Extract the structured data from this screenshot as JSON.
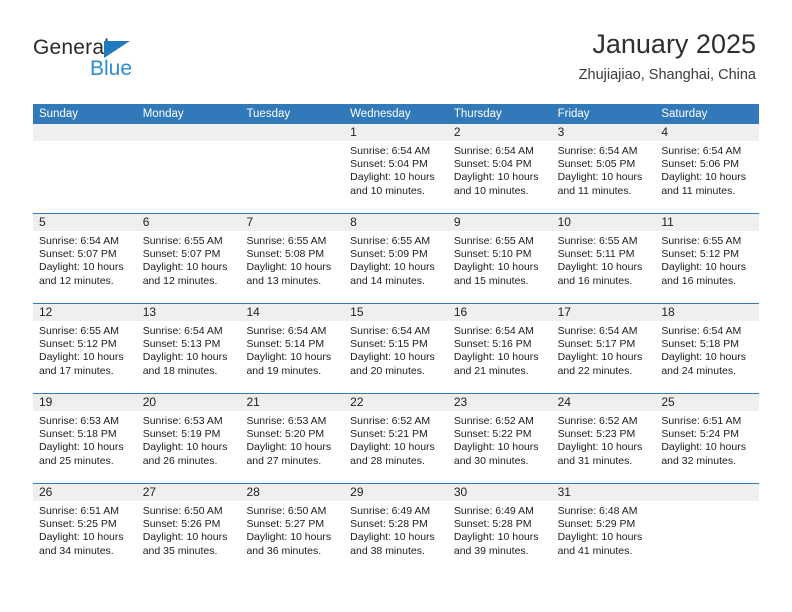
{
  "brand": {
    "name_top": "General",
    "name_bottom": "Blue",
    "accent_color": "#2e8bd0",
    "triangle_color": "#1f7ac0"
  },
  "header": {
    "title": "January 2025",
    "location": "Zhujiajiao, Shanghai, China"
  },
  "calendar": {
    "header_color": "#3279b9",
    "daynum_band_color": "#efefef",
    "weekdays": [
      "Sunday",
      "Monday",
      "Tuesday",
      "Wednesday",
      "Thursday",
      "Friday",
      "Saturday"
    ],
    "weeks": [
      [
        {
          "day": "",
          "sunrise": "",
          "sunset": "",
          "daylight": "",
          "empty": true
        },
        {
          "day": "",
          "sunrise": "",
          "sunset": "",
          "daylight": "",
          "empty": true
        },
        {
          "day": "",
          "sunrise": "",
          "sunset": "",
          "daylight": "",
          "empty": true
        },
        {
          "day": "1",
          "sunrise": "Sunrise: 6:54 AM",
          "sunset": "Sunset: 5:04 PM",
          "daylight": "Daylight: 10 hours and 10 minutes."
        },
        {
          "day": "2",
          "sunrise": "Sunrise: 6:54 AM",
          "sunset": "Sunset: 5:04 PM",
          "daylight": "Daylight: 10 hours and 10 minutes."
        },
        {
          "day": "3",
          "sunrise": "Sunrise: 6:54 AM",
          "sunset": "Sunset: 5:05 PM",
          "daylight": "Daylight: 10 hours and 11 minutes."
        },
        {
          "day": "4",
          "sunrise": "Sunrise: 6:54 AM",
          "sunset": "Sunset: 5:06 PM",
          "daylight": "Daylight: 10 hours and 11 minutes."
        }
      ],
      [
        {
          "day": "5",
          "sunrise": "Sunrise: 6:54 AM",
          "sunset": "Sunset: 5:07 PM",
          "daylight": "Daylight: 10 hours and 12 minutes."
        },
        {
          "day": "6",
          "sunrise": "Sunrise: 6:55 AM",
          "sunset": "Sunset: 5:07 PM",
          "daylight": "Daylight: 10 hours and 12 minutes."
        },
        {
          "day": "7",
          "sunrise": "Sunrise: 6:55 AM",
          "sunset": "Sunset: 5:08 PM",
          "daylight": "Daylight: 10 hours and 13 minutes."
        },
        {
          "day": "8",
          "sunrise": "Sunrise: 6:55 AM",
          "sunset": "Sunset: 5:09 PM",
          "daylight": "Daylight: 10 hours and 14 minutes."
        },
        {
          "day": "9",
          "sunrise": "Sunrise: 6:55 AM",
          "sunset": "Sunset: 5:10 PM",
          "daylight": "Daylight: 10 hours and 15 minutes."
        },
        {
          "day": "10",
          "sunrise": "Sunrise: 6:55 AM",
          "sunset": "Sunset: 5:11 PM",
          "daylight": "Daylight: 10 hours and 16 minutes."
        },
        {
          "day": "11",
          "sunrise": "Sunrise: 6:55 AM",
          "sunset": "Sunset: 5:12 PM",
          "daylight": "Daylight: 10 hours and 16 minutes."
        }
      ],
      [
        {
          "day": "12",
          "sunrise": "Sunrise: 6:55 AM",
          "sunset": "Sunset: 5:12 PM",
          "daylight": "Daylight: 10 hours and 17 minutes."
        },
        {
          "day": "13",
          "sunrise": "Sunrise: 6:54 AM",
          "sunset": "Sunset: 5:13 PM",
          "daylight": "Daylight: 10 hours and 18 minutes."
        },
        {
          "day": "14",
          "sunrise": "Sunrise: 6:54 AM",
          "sunset": "Sunset: 5:14 PM",
          "daylight": "Daylight: 10 hours and 19 minutes."
        },
        {
          "day": "15",
          "sunrise": "Sunrise: 6:54 AM",
          "sunset": "Sunset: 5:15 PM",
          "daylight": "Daylight: 10 hours and 20 minutes."
        },
        {
          "day": "16",
          "sunrise": "Sunrise: 6:54 AM",
          "sunset": "Sunset: 5:16 PM",
          "daylight": "Daylight: 10 hours and 21 minutes."
        },
        {
          "day": "17",
          "sunrise": "Sunrise: 6:54 AM",
          "sunset": "Sunset: 5:17 PM",
          "daylight": "Daylight: 10 hours and 22 minutes."
        },
        {
          "day": "18",
          "sunrise": "Sunrise: 6:54 AM",
          "sunset": "Sunset: 5:18 PM",
          "daylight": "Daylight: 10 hours and 24 minutes."
        }
      ],
      [
        {
          "day": "19",
          "sunrise": "Sunrise: 6:53 AM",
          "sunset": "Sunset: 5:18 PM",
          "daylight": "Daylight: 10 hours and 25 minutes."
        },
        {
          "day": "20",
          "sunrise": "Sunrise: 6:53 AM",
          "sunset": "Sunset: 5:19 PM",
          "daylight": "Daylight: 10 hours and 26 minutes."
        },
        {
          "day": "21",
          "sunrise": "Sunrise: 6:53 AM",
          "sunset": "Sunset: 5:20 PM",
          "daylight": "Daylight: 10 hours and 27 minutes."
        },
        {
          "day": "22",
          "sunrise": "Sunrise: 6:52 AM",
          "sunset": "Sunset: 5:21 PM",
          "daylight": "Daylight: 10 hours and 28 minutes."
        },
        {
          "day": "23",
          "sunrise": "Sunrise: 6:52 AM",
          "sunset": "Sunset: 5:22 PM",
          "daylight": "Daylight: 10 hours and 30 minutes."
        },
        {
          "day": "24",
          "sunrise": "Sunrise: 6:52 AM",
          "sunset": "Sunset: 5:23 PM",
          "daylight": "Daylight: 10 hours and 31 minutes."
        },
        {
          "day": "25",
          "sunrise": "Sunrise: 6:51 AM",
          "sunset": "Sunset: 5:24 PM",
          "daylight": "Daylight: 10 hours and 32 minutes."
        }
      ],
      [
        {
          "day": "26",
          "sunrise": "Sunrise: 6:51 AM",
          "sunset": "Sunset: 5:25 PM",
          "daylight": "Daylight: 10 hours and 34 minutes."
        },
        {
          "day": "27",
          "sunrise": "Sunrise: 6:50 AM",
          "sunset": "Sunset: 5:26 PM",
          "daylight": "Daylight: 10 hours and 35 minutes."
        },
        {
          "day": "28",
          "sunrise": "Sunrise: 6:50 AM",
          "sunset": "Sunset: 5:27 PM",
          "daylight": "Daylight: 10 hours and 36 minutes."
        },
        {
          "day": "29",
          "sunrise": "Sunrise: 6:49 AM",
          "sunset": "Sunset: 5:28 PM",
          "daylight": "Daylight: 10 hours and 38 minutes."
        },
        {
          "day": "30",
          "sunrise": "Sunrise: 6:49 AM",
          "sunset": "Sunset: 5:28 PM",
          "daylight": "Daylight: 10 hours and 39 minutes."
        },
        {
          "day": "31",
          "sunrise": "Sunrise: 6:48 AM",
          "sunset": "Sunset: 5:29 PM",
          "daylight": "Daylight: 10 hours and 41 minutes."
        },
        {
          "day": "",
          "sunrise": "",
          "sunset": "",
          "daylight": "",
          "empty": true
        }
      ]
    ]
  }
}
